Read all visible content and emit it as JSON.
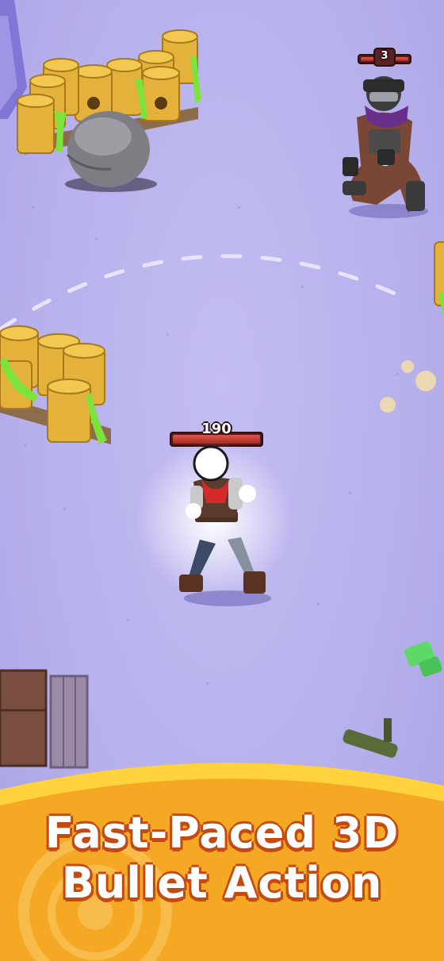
{
  "player": {
    "name": "Stickman gunslinger",
    "health": 190,
    "health_fraction": 1.0,
    "icon": "player-character-icon"
  },
  "enemy": {
    "name": "Masked soldier",
    "level": 3,
    "health_fraction": 1.0,
    "icon": "enemy-soldier-icon"
  },
  "obstacles": {
    "barrels_icon": "toxic-barrel-icon",
    "boulder_icon": "boulder-icon",
    "crate_icon": "wooden-crate-icon"
  },
  "banner": {
    "line1": "Fast-Paced 3D",
    "line2": "Bullet Action"
  },
  "colors": {
    "ground": "#b9b3ee",
    "banner": "#f5a61e",
    "banner_shadow": "#c44a12",
    "health": "#d2443b",
    "toxic": "#7be33a"
  }
}
